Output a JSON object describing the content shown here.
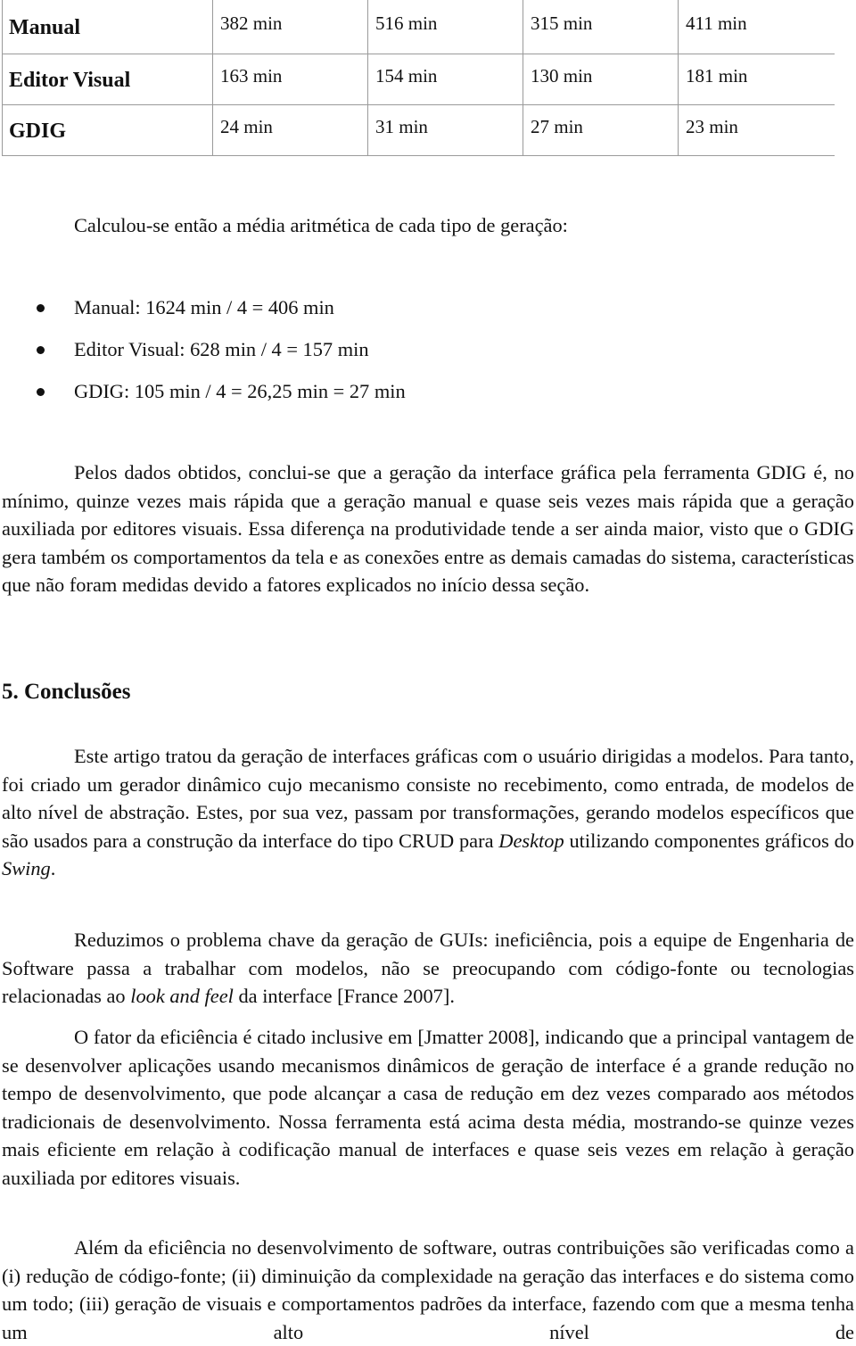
{
  "table": {
    "rows": [
      {
        "label": "Manual",
        "values": [
          "382 min",
          "516 min",
          "315 min",
          "411 min"
        ]
      },
      {
        "label": "Editor Visual",
        "values": [
          "163 min",
          "154 min",
          "130 min",
          "181 min"
        ]
      },
      {
        "label": "GDIG",
        "values": [
          "24 min",
          "31 min",
          "27 min",
          "23 min"
        ]
      }
    ]
  },
  "intro": "Calculou-se então a média aritmética de cada tipo de geração:",
  "bullets": [
    "Manual: 1624 min / 4 = 406 min",
    "Editor Visual: 628 min / 4 = 157 min",
    "GDIG: 105 min / 4 = 26,25 min = 27 min"
  ],
  "para_results": "Pelos dados obtidos, conclui-se que a geração da interface gráfica pela ferramenta GDIG é, no mínimo, quinze vezes mais rápida que a geração manual e quase seis vezes mais rápida que a geração auxiliada por editores visuais. Essa diferença na produtividade tende a ser ainda maior, visto que o GDIG gera também os comportamentos da tela e as conexões entre as demais camadas do sistema, características que não foram medidas devido a fatores explicados no início dessa seção.",
  "section_heading": "5. Conclusões",
  "para_conclusion_1": {
    "part1": "Este artigo tratou da geração de interfaces gráficas com o usuário dirigidas a modelos. Para tanto, foi criado um gerador dinâmico cujo mecanismo consiste no recebimento, como entrada, de modelos de alto nível de abstração. Estes, por sua vez, passam por transformações, gerando modelos específicos que são usados para a construção da interface do tipo CRUD para ",
    "italic1": "Desktop",
    "part2": " utilizando componentes gráficos do ",
    "italic2": "Swing",
    "part3": "."
  },
  "para_conclusion_2": {
    "part1": "Reduzimos o problema chave da geração de GUIs: ineficiência, pois a equipe de Engenharia de Software passa a trabalhar com modelos, não se preocupando com código-fonte ou tecnologias relacionadas ao ",
    "italic1": "look and feel",
    "part2": " da interface [France 2007]."
  },
  "para_conclusion_3": "O fator da eficiência é citado inclusive em [Jmatter 2008], indicando que a principal vantagem de se desenvolver aplicações usando mecanismos dinâmicos de geração de interface é a grande redução no tempo de desenvolvimento, que pode alcançar a casa de redução em dez vezes comparado aos métodos tradicionais de desenvolvimento. Nossa ferramenta está acima desta média, mostrando-se quinze vezes mais eficiente em relação à codificação manual de interfaces e quase seis vezes em relação à geração auxiliada por editores visuais.",
  "para_conclusion_4": "Além da eficiência no desenvolvimento de software, outras contribuições são verificadas como a (i) redução de código-fonte; (ii) diminuição da complexidade na geração das interfaces e do sistema como um todo; (iii) geração de visuais e comportamentos padrões da interface, fazendo com que a mesma tenha um alto nível de"
}
